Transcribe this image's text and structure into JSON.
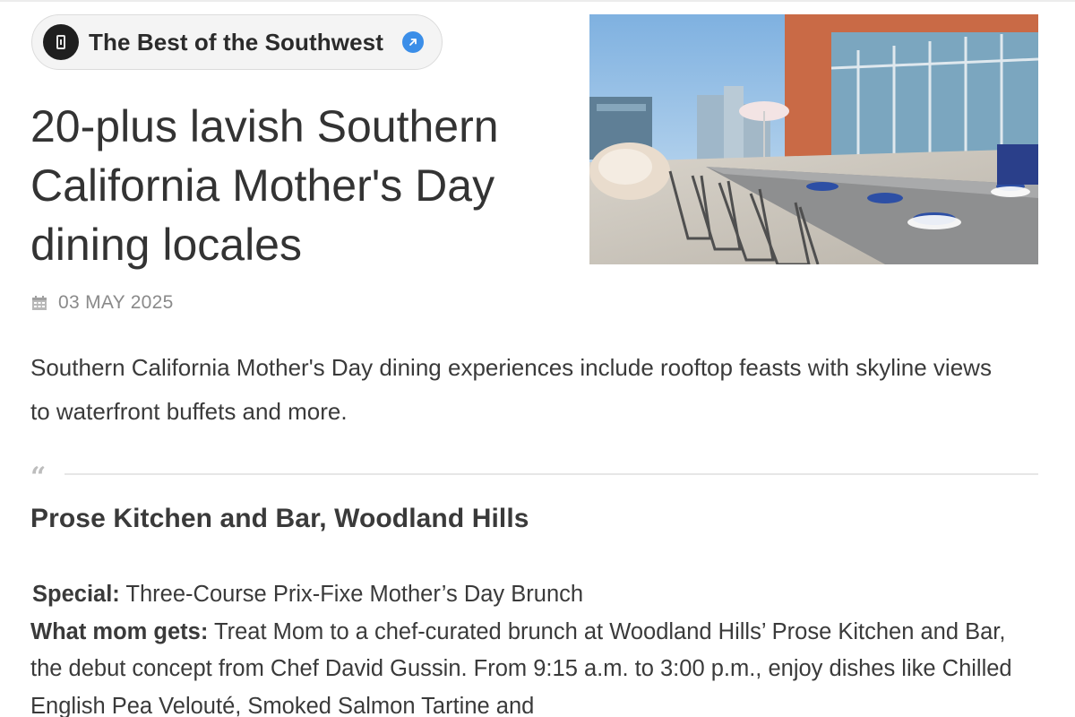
{
  "source": {
    "name": "The Best of the Southwest",
    "logo_icon": "newspaper-logo-icon",
    "link_icon": "external-link-icon",
    "accent_color": "#3b8ee8"
  },
  "article": {
    "title": "20-plus lavish Southern California Mother's Day dining locales",
    "date": "03 MAY 2025",
    "date_icon": "calendar-icon",
    "summary": "Southern California Mother's Day dining experiences include rooftop feasts with skyline views to waterfront buffets and more.",
    "quote_icon": "quote-icon"
  },
  "section": {
    "title": "Prose Kitchen and Bar, Woodland Hills",
    "special_label": "Special:",
    "special_value": "Three-Course Prix-Fixe Mother’s Day Brunch",
    "mom_label": "What mom gets:",
    "mom_value": "Treat Mom to a chef-curated brunch at Woodland Hills’ Prose Kitchen and Bar, the debut concept from Chef David Gussin. From 9:15 a.m. to 3:00 p.m., enjoy dishes like Chilled English Pea Velouté, Smoked Salmon Tartine and"
  }
}
